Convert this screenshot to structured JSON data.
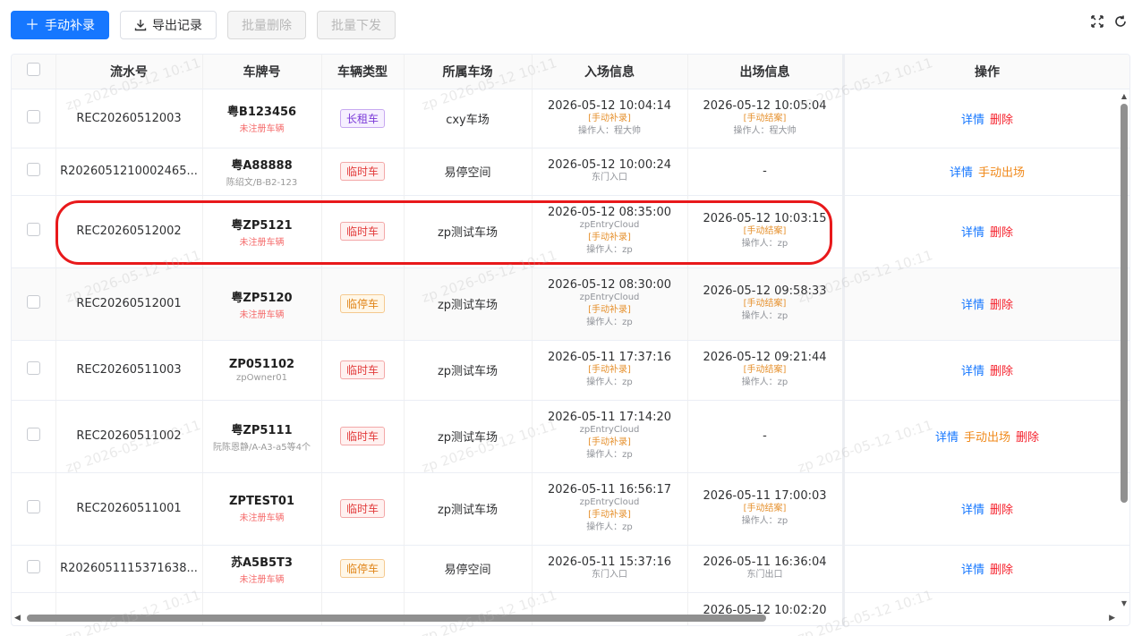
{
  "toolbar": {
    "add_label": "手动补录",
    "export_label": "导出记录",
    "batch_delete_label": "批量删除",
    "batch_issue_label": "批量下发"
  },
  "columns": [
    "流水号",
    "车牌号",
    "车辆类型",
    "所属车场",
    "入场信息",
    "出场信息",
    "操作"
  ],
  "rows": [
    {
      "serial": "REC20260512003",
      "plate": "粤B123456",
      "plate_sub": "未注册车辆",
      "plate_sub_red": true,
      "type": "长租车",
      "type_style": "long",
      "lot": "cxy车场",
      "entry_time": "2026-05-12 10:04:14",
      "entry_lines": [
        {
          "t": "[手动补录]",
          "c": "orange"
        },
        {
          "t": "操作人：程大帅",
          "c": "gray"
        }
      ],
      "exit_time": "2026-05-12 10:05:04",
      "exit_lines": [
        {
          "t": "[手动结案]",
          "c": "orange"
        },
        {
          "t": "操作人：程大帅",
          "c": "gray"
        }
      ],
      "ops": [
        {
          "t": "详情",
          "c": "blue"
        },
        {
          "t": "删除",
          "c": "red"
        }
      ]
    },
    {
      "serial": "R2026051210002465...",
      "plate": "粤A88888",
      "plate_sub": "陈绍文/B-B2-123",
      "plate_sub_red": false,
      "type": "临时车",
      "type_style": "temp",
      "lot": "易停空间",
      "entry_time": "2026-05-12 10:00:24",
      "entry_lines": [
        {
          "t": "东门入口",
          "c": "gray"
        }
      ],
      "exit_time": "-",
      "exit_lines": [],
      "ops": [
        {
          "t": "详情",
          "c": "blue"
        },
        {
          "t": "手动出场",
          "c": "orange"
        }
      ]
    },
    {
      "serial": "REC20260512002",
      "plate": "粤ZP5121",
      "plate_sub": "未注册车辆",
      "plate_sub_red": true,
      "type": "临时车",
      "type_style": "temp",
      "lot": "zp测试车场",
      "entry_time": "2026-05-12 08:35:00",
      "entry_lines": [
        {
          "t": "zpEntryCloud",
          "c": "gray"
        },
        {
          "t": "[手动补录]",
          "c": "orange"
        },
        {
          "t": "操作人：zp",
          "c": "gray"
        }
      ],
      "exit_time": "2026-05-12 10:03:15",
      "exit_lines": [
        {
          "t": "[手动结案]",
          "c": "orange"
        },
        {
          "t": "操作人：zp",
          "c": "gray"
        }
      ],
      "ops": [
        {
          "t": "详情",
          "c": "blue"
        },
        {
          "t": "删除",
          "c": "red"
        }
      ]
    },
    {
      "serial": "REC20260512001",
      "plate": "粤ZP5120",
      "plate_sub": "未注册车辆",
      "plate_sub_red": true,
      "type": "临停车",
      "type_style": "park",
      "lot": "zp测试车场",
      "entry_time": "2026-05-12 08:30:00",
      "entry_lines": [
        {
          "t": "zpEntryCloud",
          "c": "gray"
        },
        {
          "t": "[手动补录]",
          "c": "orange"
        },
        {
          "t": "操作人：zp",
          "c": "gray"
        }
      ],
      "exit_time": "2026-05-12 09:58:33",
      "exit_lines": [
        {
          "t": "[手动结案]",
          "c": "orange"
        },
        {
          "t": "操作人：zp",
          "c": "gray"
        }
      ],
      "ops": [
        {
          "t": "详情",
          "c": "blue"
        },
        {
          "t": "删除",
          "c": "red"
        }
      ]
    },
    {
      "serial": "REC20260511003",
      "plate": "ZP051102",
      "plate_sub": "zpOwner01",
      "plate_sub_red": false,
      "type": "临时车",
      "type_style": "temp",
      "lot": "zp测试车场",
      "entry_time": "2026-05-11 17:37:16",
      "entry_lines": [
        {
          "t": "[手动补录]",
          "c": "orange"
        },
        {
          "t": "操作人：zp",
          "c": "gray"
        }
      ],
      "exit_time": "2026-05-12 09:21:44",
      "exit_lines": [
        {
          "t": "[手动结案]",
          "c": "orange"
        },
        {
          "t": "操作人：zp",
          "c": "gray"
        }
      ],
      "ops": [
        {
          "t": "详情",
          "c": "blue"
        },
        {
          "t": "删除",
          "c": "red"
        }
      ]
    },
    {
      "serial": "REC20260511002",
      "plate": "粤ZP5111",
      "plate_sub": "阮陈恩静/A-A3-a5等4个",
      "plate_sub_red": false,
      "type": "临时车",
      "type_style": "temp",
      "lot": "zp测试车场",
      "entry_time": "2026-05-11 17:14:20",
      "entry_lines": [
        {
          "t": "zpEntryCloud",
          "c": "gray"
        },
        {
          "t": "[手动补录]",
          "c": "orange"
        },
        {
          "t": "操作人：zp",
          "c": "gray"
        }
      ],
      "exit_time": "-",
      "exit_lines": [],
      "ops": [
        {
          "t": "详情",
          "c": "blue"
        },
        {
          "t": "手动出场",
          "c": "orange"
        },
        {
          "t": "删除",
          "c": "red"
        }
      ]
    },
    {
      "serial": "REC20260511001",
      "plate": "ZPTEST01",
      "plate_sub": "未注册车辆",
      "plate_sub_red": true,
      "type": "临时车",
      "type_style": "temp",
      "lot": "zp测试车场",
      "entry_time": "2026-05-11 16:56:17",
      "entry_lines": [
        {
          "t": "zpEntryCloud",
          "c": "gray"
        },
        {
          "t": "[手动补录]",
          "c": "orange"
        },
        {
          "t": "操作人：zp",
          "c": "gray"
        }
      ],
      "exit_time": "2026-05-11 17:00:03",
      "exit_lines": [
        {
          "t": "[手动结案]",
          "c": "orange"
        },
        {
          "t": "操作人：zp",
          "c": "gray"
        }
      ],
      "ops": [
        {
          "t": "详情",
          "c": "blue"
        },
        {
          "t": "删除",
          "c": "red"
        }
      ]
    },
    {
      "serial": "R2026051115371638...",
      "plate": "苏A5B5T3",
      "plate_sub": "未注册车辆",
      "plate_sub_red": true,
      "type": "临停车",
      "type_style": "park",
      "lot": "易停空间",
      "entry_time": "2026-05-11 15:37:16",
      "entry_lines": [
        {
          "t": "东门入口",
          "c": "gray"
        }
      ],
      "exit_time": "2026-05-11 16:36:04",
      "exit_lines": [
        {
          "t": "东门出口",
          "c": "gray"
        }
      ],
      "ops": [
        {
          "t": "详情",
          "c": "blue"
        },
        {
          "t": "删除",
          "c": "red"
        }
      ]
    },
    {
      "serial": "",
      "plate": "",
      "plate_sub": "",
      "plate_sub_red": false,
      "type": "",
      "type_style": "",
      "lot": "",
      "entry_time": "",
      "entry_lines": [],
      "exit_time": "2026-05-12 10:02:20",
      "exit_lines": [],
      "ops": []
    }
  ],
  "watermark": "zp 2026-05-12 10:11",
  "colors": {
    "primary": "#1677ff",
    "danger": "#f5222d",
    "warning": "#f08a1c",
    "highlight_ring": "#e8191b"
  },
  "icons": {
    "add": "plus-icon",
    "export": "download-icon",
    "fullscreen": "fullscreen-icon",
    "refresh": "refresh-icon"
  }
}
